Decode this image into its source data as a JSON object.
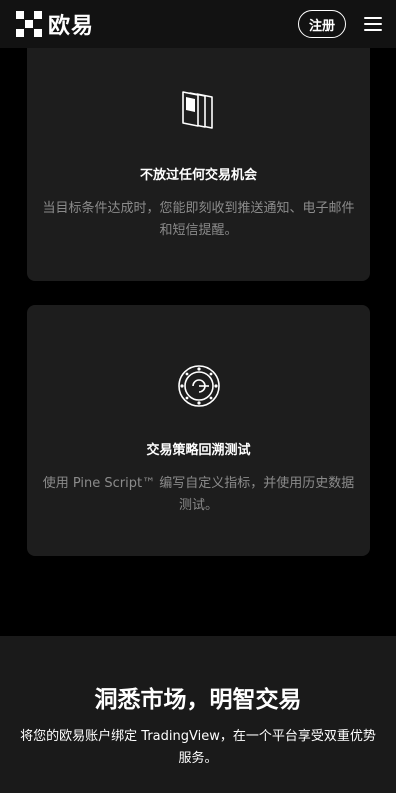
{
  "header": {
    "brand": "欧易",
    "register_label": "注册"
  },
  "cards": [
    {
      "icon": "stacked-cards-icon",
      "title": "不放过任何交易机会",
      "description": "当目标条件达成时，您能即刻收到推送通知、电子邮件和短信提醒。"
    },
    {
      "icon": "backtest-target-icon",
      "title": "交易策略回溯测试",
      "description": "使用 Pine Script™ 编写自定义指标，并使用历史数据测试。"
    }
  ],
  "promo": {
    "title": "洞悉市场，明智交易",
    "description": "将您的欧易账户绑定 TradingView，在一个平台享受双重优势服务。"
  },
  "colors": {
    "page_background": "#000000",
    "header_background": "#121212",
    "card_background": "#1d1d1d",
    "muted_text": "#8b8b8b"
  }
}
